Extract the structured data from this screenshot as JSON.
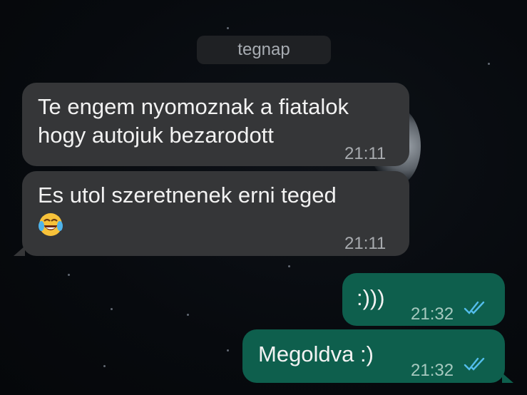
{
  "date_separator": "tegnap",
  "messages": [
    {
      "direction": "incoming",
      "lines": [
        "Te engem nyomoznak a fiatalok",
        "hogy autojuk bezarodott"
      ],
      "time": "21:11"
    },
    {
      "direction": "incoming",
      "text": "Es utol szeretnenek erni teged",
      "emoji": "face-with-tears-of-joy",
      "time": "21:11"
    },
    {
      "direction": "outgoing",
      "text": ":)))",
      "time": "21:32",
      "status": "read"
    },
    {
      "direction": "outgoing",
      "text": "Megoldva :)",
      "time": "21:32",
      "status": "read"
    }
  ],
  "colors": {
    "incoming_bubble": "#353638",
    "outgoing_bubble": "#0e5f4d",
    "read_ticks": "#53bdeb"
  }
}
